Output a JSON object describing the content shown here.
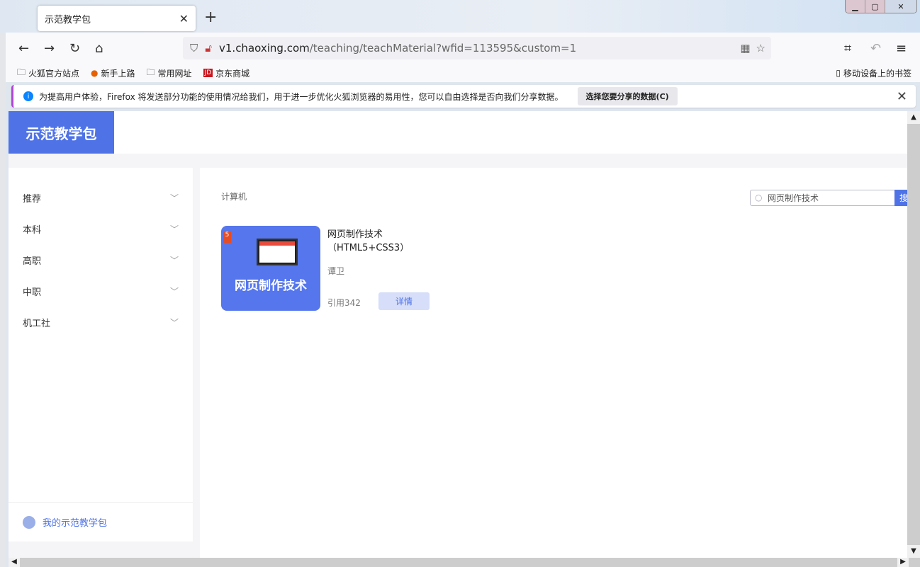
{
  "browser": {
    "tab_title": "示范教学包",
    "url_host": "v1.chaoxing.com",
    "url_path": "/teaching/teachMaterial?wfid=113595&custom=1",
    "bookmarks": [
      "火狐官方站点",
      "新手上路",
      "常用网址",
      "京东商城"
    ],
    "mobile_bookmarks": "移动设备上的书签",
    "notice": {
      "text": "为提高用户体验，Firefox 将发送部分功能的使用情况给我们，用于进一步优化火狐浏览器的易用性，您可以自由选择是否向我们分享数据。",
      "button": "选择您要分享的数据(C)"
    }
  },
  "site": {
    "logo": "示范教学包"
  },
  "sidebar": {
    "items": [
      {
        "label": "推荐"
      },
      {
        "label": "本科"
      },
      {
        "label": "高职"
      },
      {
        "label": "中职"
      },
      {
        "label": "机工社"
      }
    ],
    "mine": "我的示范教学包"
  },
  "main": {
    "category": "计算机",
    "search": {
      "value": "网页制作技术",
      "button": "搜"
    },
    "books": [
      {
        "cover_title": "网页制作技术",
        "cover_badge": "5",
        "title_line1": "网页制作技术",
        "title_line2": "（HTML5+CSS3）",
        "author": "谭卫",
        "citations": "引用342",
        "detail": "详情"
      }
    ]
  }
}
